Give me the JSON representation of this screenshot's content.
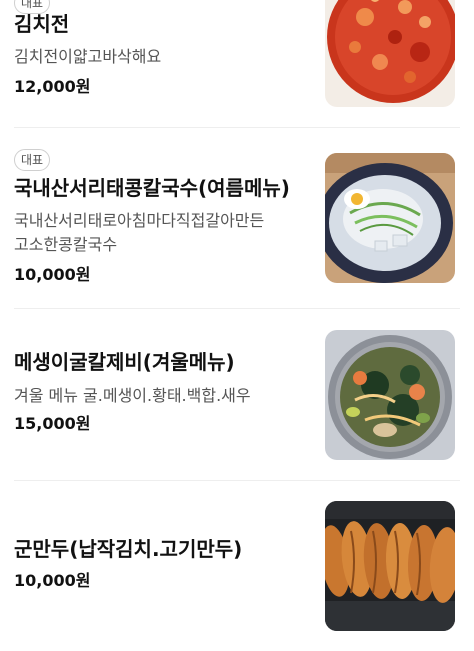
{
  "badge_label": "대표",
  "menu": [
    {
      "badge": "대표",
      "name": "김치전",
      "description": "김치전이얇고바삭해요",
      "price": "12,000원",
      "image": "kimchi-pancake-image"
    },
    {
      "badge": "대표",
      "name": "국내산서리태콩칼국수(여름메뉴)",
      "description_lines": [
        "국내산서리태로아침마다직접갈아만든",
        "고소한콩칼국수"
      ],
      "price": "10,000원",
      "image": "soybean-noodle-soup-image"
    },
    {
      "name": "메생이굴칼제비(겨울메뉴)",
      "description": "겨울 메뉴 굴.메생이.황태.백합.새우",
      "price": "15,000원",
      "image": "seaweed-oyster-noodle-image"
    },
    {
      "name": "군만두(납작김치.고기만두)",
      "price": "10,000원",
      "image": "fried-dumplings-image"
    }
  ]
}
